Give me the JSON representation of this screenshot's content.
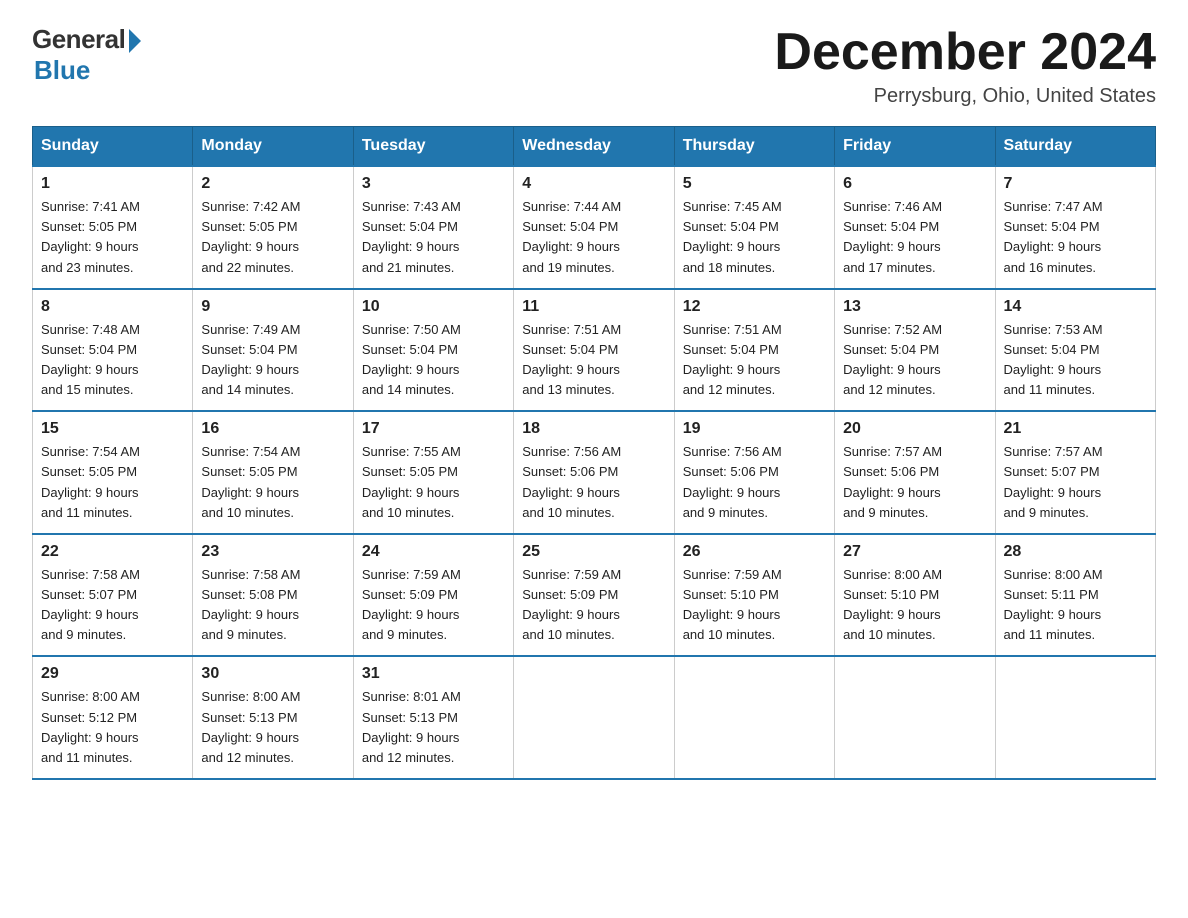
{
  "header": {
    "logo_general": "General",
    "logo_blue": "Blue",
    "month_title": "December 2024",
    "location": "Perrysburg, Ohio, United States"
  },
  "days_of_week": [
    "Sunday",
    "Monday",
    "Tuesday",
    "Wednesday",
    "Thursday",
    "Friday",
    "Saturday"
  ],
  "weeks": [
    [
      {
        "num": "1",
        "sunrise": "7:41 AM",
        "sunset": "5:05 PM",
        "daylight": "9 hours and 23 minutes."
      },
      {
        "num": "2",
        "sunrise": "7:42 AM",
        "sunset": "5:05 PM",
        "daylight": "9 hours and 22 minutes."
      },
      {
        "num": "3",
        "sunrise": "7:43 AM",
        "sunset": "5:04 PM",
        "daylight": "9 hours and 21 minutes."
      },
      {
        "num": "4",
        "sunrise": "7:44 AM",
        "sunset": "5:04 PM",
        "daylight": "9 hours and 19 minutes."
      },
      {
        "num": "5",
        "sunrise": "7:45 AM",
        "sunset": "5:04 PM",
        "daylight": "9 hours and 18 minutes."
      },
      {
        "num": "6",
        "sunrise": "7:46 AM",
        "sunset": "5:04 PM",
        "daylight": "9 hours and 17 minutes."
      },
      {
        "num": "7",
        "sunrise": "7:47 AM",
        "sunset": "5:04 PM",
        "daylight": "9 hours and 16 minutes."
      }
    ],
    [
      {
        "num": "8",
        "sunrise": "7:48 AM",
        "sunset": "5:04 PM",
        "daylight": "9 hours and 15 minutes."
      },
      {
        "num": "9",
        "sunrise": "7:49 AM",
        "sunset": "5:04 PM",
        "daylight": "9 hours and 14 minutes."
      },
      {
        "num": "10",
        "sunrise": "7:50 AM",
        "sunset": "5:04 PM",
        "daylight": "9 hours and 14 minutes."
      },
      {
        "num": "11",
        "sunrise": "7:51 AM",
        "sunset": "5:04 PM",
        "daylight": "9 hours and 13 minutes."
      },
      {
        "num": "12",
        "sunrise": "7:51 AM",
        "sunset": "5:04 PM",
        "daylight": "9 hours and 12 minutes."
      },
      {
        "num": "13",
        "sunrise": "7:52 AM",
        "sunset": "5:04 PM",
        "daylight": "9 hours and 12 minutes."
      },
      {
        "num": "14",
        "sunrise": "7:53 AM",
        "sunset": "5:04 PM",
        "daylight": "9 hours and 11 minutes."
      }
    ],
    [
      {
        "num": "15",
        "sunrise": "7:54 AM",
        "sunset": "5:05 PM",
        "daylight": "9 hours and 11 minutes."
      },
      {
        "num": "16",
        "sunrise": "7:54 AM",
        "sunset": "5:05 PM",
        "daylight": "9 hours and 10 minutes."
      },
      {
        "num": "17",
        "sunrise": "7:55 AM",
        "sunset": "5:05 PM",
        "daylight": "9 hours and 10 minutes."
      },
      {
        "num": "18",
        "sunrise": "7:56 AM",
        "sunset": "5:06 PM",
        "daylight": "9 hours and 10 minutes."
      },
      {
        "num": "19",
        "sunrise": "7:56 AM",
        "sunset": "5:06 PM",
        "daylight": "9 hours and 9 minutes."
      },
      {
        "num": "20",
        "sunrise": "7:57 AM",
        "sunset": "5:06 PM",
        "daylight": "9 hours and 9 minutes."
      },
      {
        "num": "21",
        "sunrise": "7:57 AM",
        "sunset": "5:07 PM",
        "daylight": "9 hours and 9 minutes."
      }
    ],
    [
      {
        "num": "22",
        "sunrise": "7:58 AM",
        "sunset": "5:07 PM",
        "daylight": "9 hours and 9 minutes."
      },
      {
        "num": "23",
        "sunrise": "7:58 AM",
        "sunset": "5:08 PM",
        "daylight": "9 hours and 9 minutes."
      },
      {
        "num": "24",
        "sunrise": "7:59 AM",
        "sunset": "5:09 PM",
        "daylight": "9 hours and 9 minutes."
      },
      {
        "num": "25",
        "sunrise": "7:59 AM",
        "sunset": "5:09 PM",
        "daylight": "9 hours and 10 minutes."
      },
      {
        "num": "26",
        "sunrise": "7:59 AM",
        "sunset": "5:10 PM",
        "daylight": "9 hours and 10 minutes."
      },
      {
        "num": "27",
        "sunrise": "8:00 AM",
        "sunset": "5:10 PM",
        "daylight": "9 hours and 10 minutes."
      },
      {
        "num": "28",
        "sunrise": "8:00 AM",
        "sunset": "5:11 PM",
        "daylight": "9 hours and 11 minutes."
      }
    ],
    [
      {
        "num": "29",
        "sunrise": "8:00 AM",
        "sunset": "5:12 PM",
        "daylight": "9 hours and 11 minutes."
      },
      {
        "num": "30",
        "sunrise": "8:00 AM",
        "sunset": "5:13 PM",
        "daylight": "9 hours and 12 minutes."
      },
      {
        "num": "31",
        "sunrise": "8:01 AM",
        "sunset": "5:13 PM",
        "daylight": "9 hours and 12 minutes."
      },
      null,
      null,
      null,
      null
    ]
  ],
  "labels": {
    "sunrise": "Sunrise: ",
    "sunset": "Sunset: ",
    "daylight": "Daylight: "
  }
}
